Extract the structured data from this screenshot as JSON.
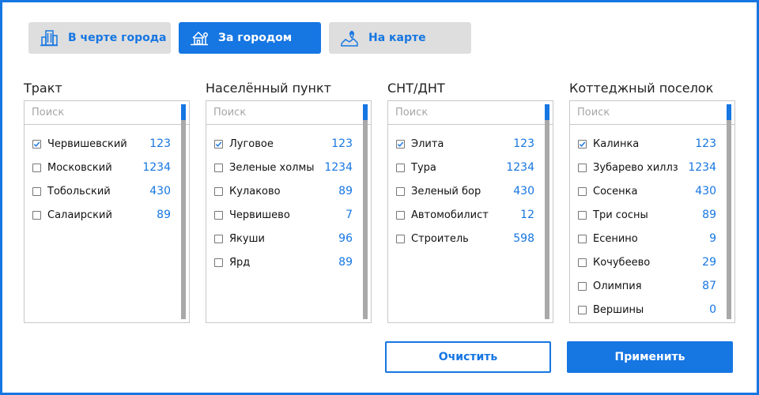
{
  "tabs": [
    {
      "label": "В черте города",
      "icon": "city-buildings-icon",
      "active": false
    },
    {
      "label": "За городом",
      "icon": "country-house-icon",
      "active": true
    },
    {
      "label": "На карте",
      "icon": "map-pin-icon",
      "active": false
    }
  ],
  "columns": [
    {
      "title": "Тракт",
      "search_placeholder": "Поиск",
      "items": [
        {
          "label": "Червишевский",
          "count": "123",
          "checked": true
        },
        {
          "label": "Московский",
          "count": "1234",
          "checked": false
        },
        {
          "label": "Тобольский",
          "count": "430",
          "checked": false
        },
        {
          "label": "Салаирский",
          "count": "89",
          "checked": false
        }
      ]
    },
    {
      "title": "Населённый пункт",
      "search_placeholder": "Поиск",
      "items": [
        {
          "label": "Луговое",
          "count": "123",
          "checked": true
        },
        {
          "label": "Зеленые холмы",
          "count": "1234",
          "checked": false
        },
        {
          "label": "Кулаково",
          "count": "89",
          "checked": false
        },
        {
          "label": "Червишево",
          "count": "7",
          "checked": false
        },
        {
          "label": "Якуши",
          "count": "96",
          "checked": false
        },
        {
          "label": "Ярд",
          "count": "89",
          "checked": false
        }
      ]
    },
    {
      "title": "СНТ/ДНТ",
      "search_placeholder": "Поиск",
      "items": [
        {
          "label": "Элита",
          "count": "123",
          "checked": true
        },
        {
          "label": "Тура",
          "count": "1234",
          "checked": false
        },
        {
          "label": "Зеленый бор",
          "count": "430",
          "checked": false
        },
        {
          "label": "Автомобилист",
          "count": "12",
          "checked": false
        },
        {
          "label": "Строитель",
          "count": "598",
          "checked": false
        }
      ]
    },
    {
      "title": "Коттеджный поселок",
      "search_placeholder": "Поиск",
      "items": [
        {
          "label": "Калинка",
          "count": "123",
          "checked": true
        },
        {
          "label": "Зубарево хиллз",
          "count": "1234",
          "checked": false
        },
        {
          "label": "Сосенка",
          "count": "430",
          "checked": false
        },
        {
          "label": "Три сосны",
          "count": "89",
          "checked": false
        },
        {
          "label": "Есенино",
          "count": "9",
          "checked": false
        },
        {
          "label": "Кочубеево",
          "count": "29",
          "checked": false
        },
        {
          "label": "Олимпия",
          "count": "87",
          "checked": false
        },
        {
          "label": "Вершины",
          "count": "0",
          "checked": false
        }
      ]
    }
  ],
  "buttons": {
    "clear_label": "Очистить",
    "apply_label": "Применить"
  },
  "colors": {
    "accent": "#1676e2",
    "tab_inactive_bg": "#dedede",
    "scrollbar_track": "#a9a9a9"
  }
}
